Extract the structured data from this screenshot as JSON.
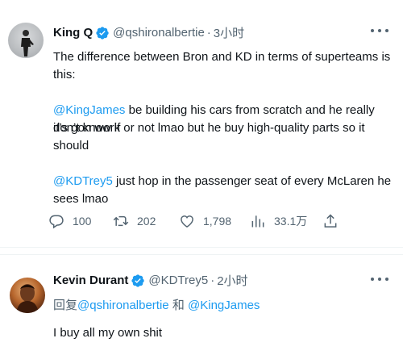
{
  "main_tweet": {
    "author_name": "King Q",
    "handle": "@qshironalbertie",
    "time": "3小时",
    "line1": "The difference between Bron and KD in terms of superteams is this:",
    "para2_mention": "@KingJames",
    "para2_line1": " be building his cars from scratch and he really don’t know if",
    "para2_line2": "it’s gon work or not lmao but he buy high-quality parts so it should",
    "para3_mention": "@KDTrey5",
    "para3_text": " just hop in the passenger seat of every McLaren he sees lmao",
    "replies": "100",
    "retweets": "202",
    "likes": "1,798",
    "views": "33.1万"
  },
  "reply_tweet": {
    "author_name": "Kevin Durant",
    "handle": "@KDTrey5",
    "time": "2小时",
    "reply_prefix": "回复",
    "reply_to_1": "@qshironalbertie",
    "reply_and": "和",
    "reply_to_2": "@KingJames",
    "body": "I buy all my own shit"
  },
  "colors": {
    "accent": "#1d9bf0",
    "secondary_text": "#536471",
    "primary_text": "#0f1419"
  },
  "icons": [
    "verified-badge-icon",
    "more-icon",
    "reply-icon",
    "retweet-icon",
    "like-icon",
    "views-icon",
    "share-icon"
  ]
}
